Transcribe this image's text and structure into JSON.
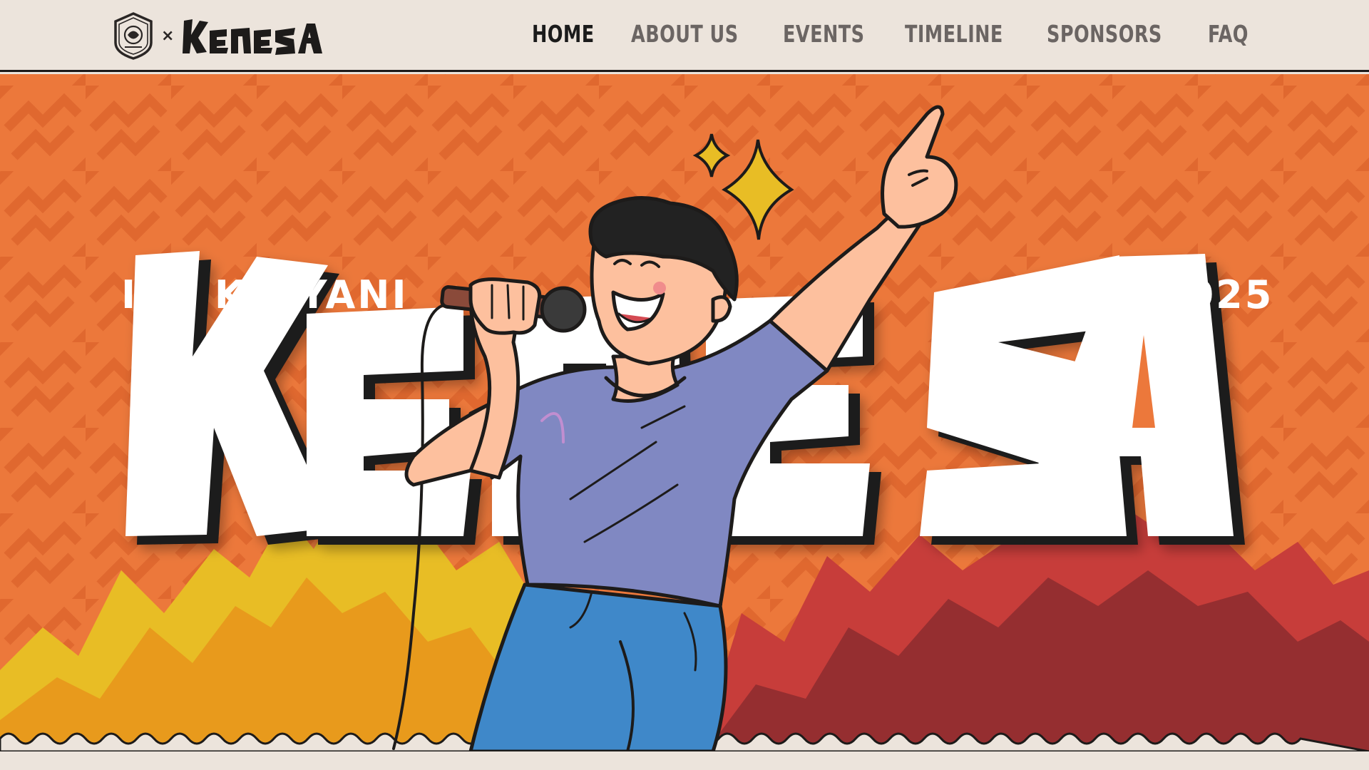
{
  "brand": {
    "separator": "×",
    "wordmark": "Kenesa",
    "crest_icon": "college-crest-icon"
  },
  "nav": {
    "items": [
      {
        "label": "HOME",
        "active": true
      },
      {
        "label": "ABOUT US",
        "active": false
      },
      {
        "label": "EVENTS",
        "active": false
      },
      {
        "label": "TIMELINE",
        "active": false
      },
      {
        "label": "SPONSORS",
        "active": false
      },
      {
        "label": "FAQ",
        "active": false
      }
    ]
  },
  "hero": {
    "location": "IIIT KALYANI",
    "year": "2025",
    "title": "KENESA",
    "illustration": "singer-with-microphone-illustration"
  },
  "colors": {
    "background": "#ece4dc",
    "hero_orange": "#ec783b",
    "pattern_orange": "#e26b33",
    "yellow": "#e8bd25",
    "amber": "#e89a1c",
    "red": "#c73d3a",
    "dark_red": "#952e30",
    "shirt": "#8088c2",
    "jeans": "#3f88c9",
    "ink": "#1d1b1a"
  }
}
